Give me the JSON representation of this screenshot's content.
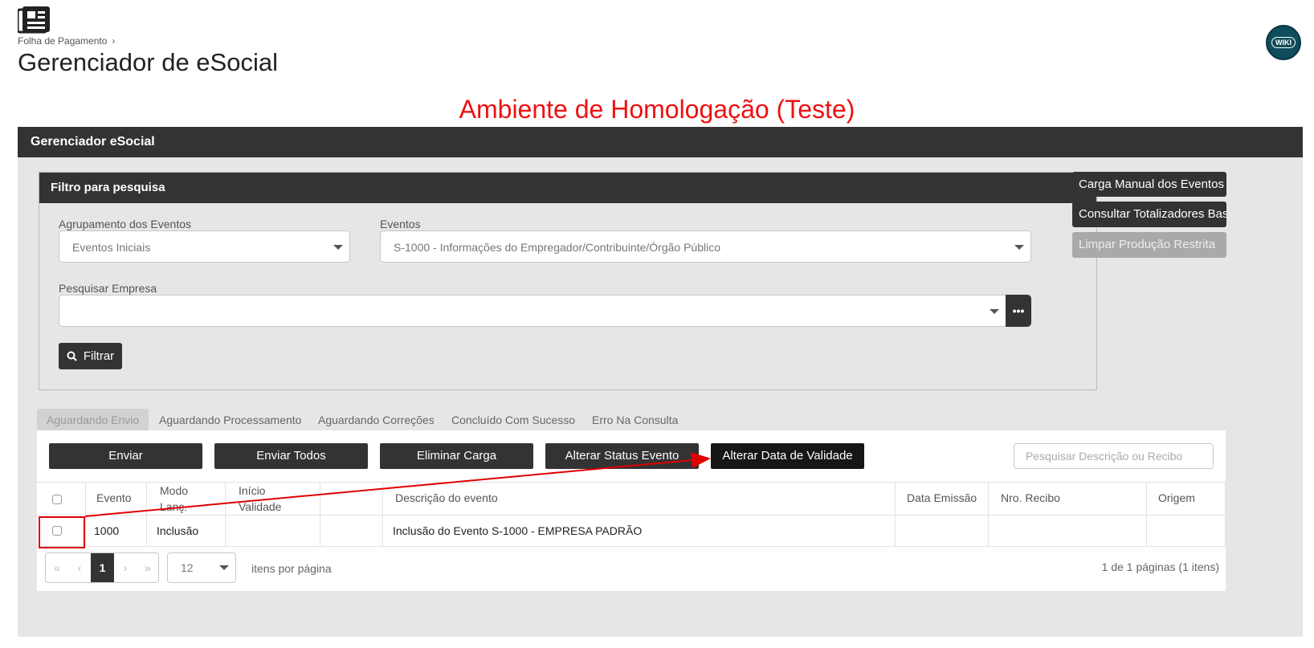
{
  "header": {
    "breadcrumb": "Folha de Pagamento",
    "breadcrumb_sep": "›",
    "title": "Gerenciador de eSocial",
    "wiki_label": "WIKI",
    "app_icon": "newspaper-icon"
  },
  "environment_banner": "Ambiente de Homologação (Teste)",
  "panel": {
    "title": "Gerenciador eSocial",
    "filter": {
      "title": "Filtro para pesquisa",
      "grouping_label": "Agrupamento dos Eventos",
      "grouping_value": "Eventos Iniciais",
      "events_label": "Eventos",
      "events_value": "S-1000 - Informações do Empregador/Contribuinte/Órgão Público",
      "company_label": "Pesquisar Empresa",
      "company_value": "",
      "ellipsis_label": "•••",
      "filter_button": "Filtrar"
    },
    "side_buttons": [
      {
        "label": "Carga Manual dos Eventos"
      },
      {
        "label": "Consultar Totalizadores Base"
      },
      {
        "label": "Limpar Produção Restrita"
      }
    ],
    "tabs": [
      {
        "label": "Aguardando Envio"
      },
      {
        "label": "Aguardando Processamento"
      },
      {
        "label": "Aguardando Correções"
      },
      {
        "label": "Concluído Com Sucesso"
      },
      {
        "label": "Erro Na Consulta"
      }
    ],
    "actions": {
      "send": "Enviar",
      "send_all": "Enviar Todos",
      "delete_load": "Eliminar Carga",
      "change_status": "Alterar Status Evento",
      "change_validity": "Alterar Data de Validade",
      "search_placeholder": "Pesquisar Descrição ou Recibo"
    },
    "grid": {
      "columns": {
        "event": "Evento",
        "mode_line1": "Modo",
        "mode_line2": "Lanç.",
        "start_line1": "Início",
        "start_line2": "Validade",
        "extra": "",
        "description": "Descrição do evento",
        "issue_date": "Data Emissão",
        "receipt": "Nro. Recibo",
        "origin": "Origem"
      },
      "rows": [
        {
          "event": "1000",
          "mode": "Inclusão",
          "start": "",
          "extra": "",
          "description": "Inclusão do Evento S-1000 - EMPRESA PADRÃO",
          "issue_date": "",
          "receipt": "",
          "origin": ""
        }
      ]
    },
    "pager": {
      "first": "«",
      "prev": "‹",
      "current_page": "1",
      "next": "›",
      "last": "»",
      "page_size": "12",
      "per_page_label": "itens por página",
      "summary": "1 de 1 páginas (1 itens)"
    }
  },
  "colors": {
    "banner": "#ee1111",
    "header_bg": "#333333",
    "panel_bg": "#e6e6e6",
    "annotation": "#e00000"
  }
}
